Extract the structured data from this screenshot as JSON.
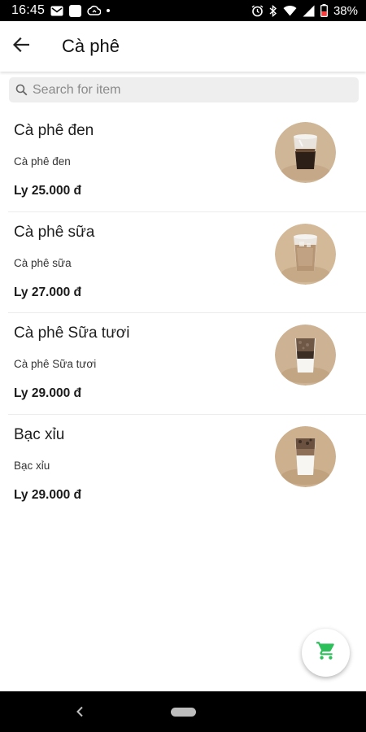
{
  "status_bar": {
    "time": "16:45",
    "battery_percent": "38%",
    "icons": [
      "gmail-icon",
      "notification-square-icon",
      "cloud-sync-icon",
      "alarm-icon",
      "bluetooth-icon",
      "wifi-icon",
      "cellular-signal-icon",
      "battery-icon"
    ]
  },
  "app_bar": {
    "back_icon": "arrow-left-icon",
    "title": "Cà phê"
  },
  "search": {
    "icon": "search-icon",
    "placeholder": "Search for item",
    "value": ""
  },
  "items": [
    {
      "name": "Cà phê đen",
      "description": "Cà phê đen",
      "price": "Ly 25.000 đ",
      "image": "black-coffee-cup-image"
    },
    {
      "name": "Cà phê sữa",
      "description": "Cà phê sữa",
      "price": "Ly 27.000 đ",
      "image": "milk-coffee-cup-image"
    },
    {
      "name": "Cà phê Sữa tươi",
      "description": "Cà phê Sữa tươi",
      "price": "Ly 29.000 đ",
      "image": "fresh-milk-coffee-cup-image"
    },
    {
      "name": "Bạc xỉu",
      "description": "Bạc xỉu",
      "price": "Ly 29.000 đ",
      "image": "bac-xiu-cup-image"
    }
  ],
  "cart_fab": {
    "icon": "shopping-cart-icon",
    "color": "#2dbf5a"
  },
  "colors": {
    "accent_green": "#2dbf5a",
    "search_bg": "#eeeeee",
    "status_bar_bg": "#000000"
  }
}
